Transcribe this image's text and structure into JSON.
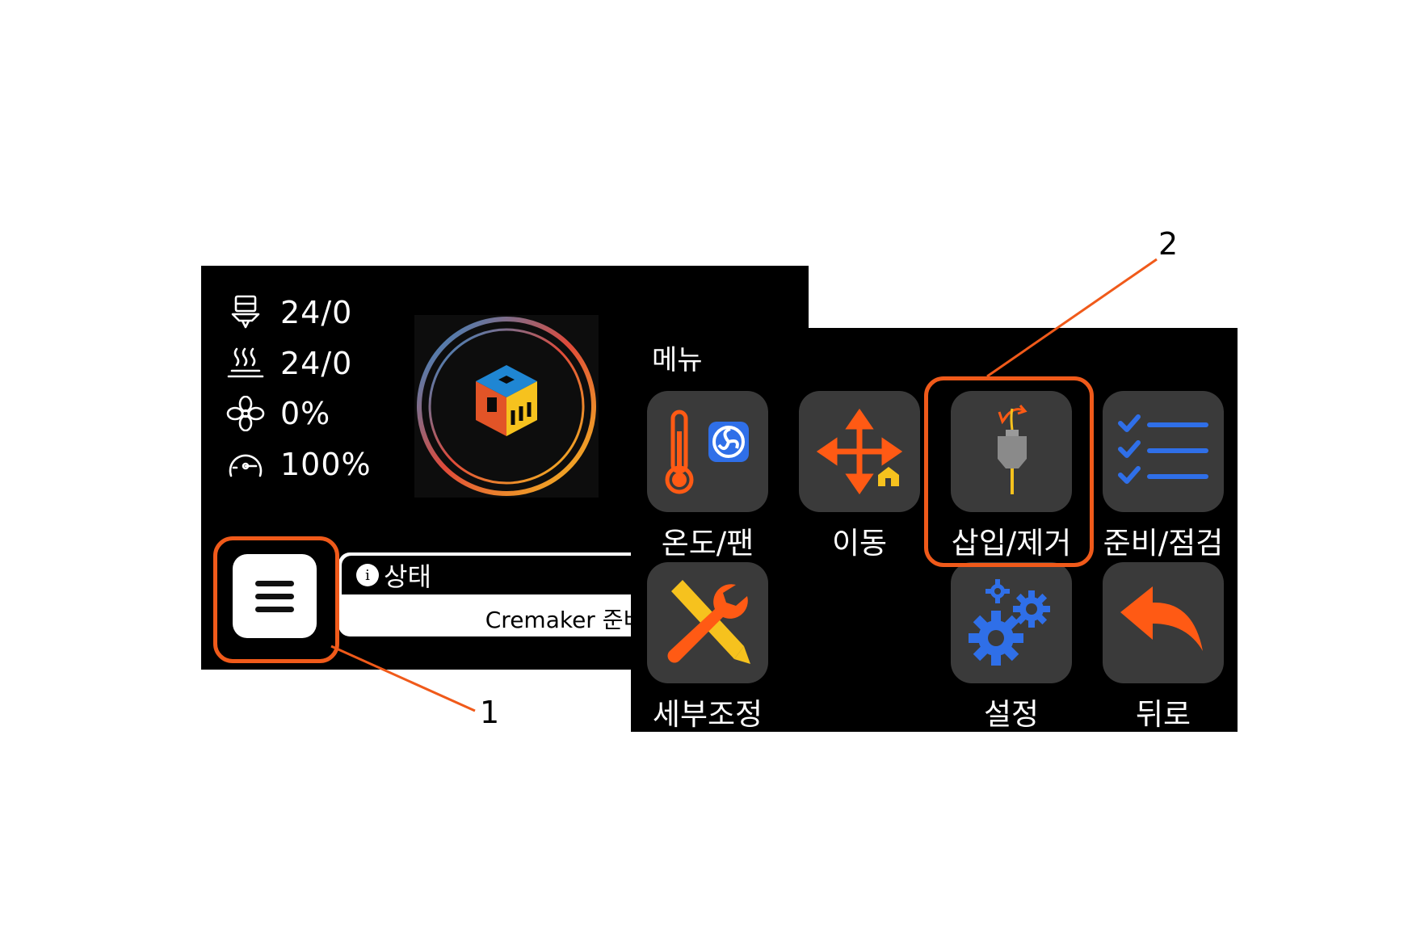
{
  "main_screen": {
    "stats": [
      {
        "icon": "nozzle-icon",
        "value": "24/0"
      },
      {
        "icon": "heated-bed-icon",
        "value": "24/0"
      },
      {
        "icon": "fan-icon",
        "value": "0%"
      },
      {
        "icon": "speed-gauge-icon",
        "value": "100%"
      }
    ],
    "logo_icon": "cremaker-cube-logo",
    "menu_button_icon": "hamburger-icon",
    "status": {
      "icon": "info-icon",
      "info_glyph": "i",
      "title": "상태",
      "text": "Cremaker 준비"
    }
  },
  "menu_screen": {
    "title": "메뉴",
    "items": [
      {
        "label": "온도/팬",
        "icon": "thermometer-fan-icon"
      },
      {
        "label": "이동",
        "icon": "move-arrows-home-icon"
      },
      {
        "label": "삽입/제거",
        "icon": "filament-load-icon"
      },
      {
        "label": "준비/점검",
        "icon": "checklist-icon"
      },
      {
        "label": "세부조정",
        "icon": "tools-icon"
      },
      {
        "label": "설정",
        "icon": "gears-icon"
      },
      {
        "label": "뒤로",
        "icon": "back-arrow-icon"
      }
    ]
  },
  "callouts": [
    "1",
    "2"
  ],
  "colors": {
    "highlight": "#f05a1a",
    "orange": "#ff5a14",
    "blue": "#2f6fe8",
    "tile": "#3a3a3a",
    "screen": "#000000"
  }
}
